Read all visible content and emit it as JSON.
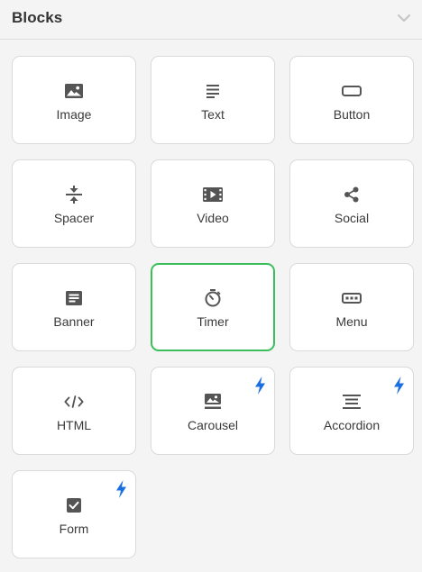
{
  "panel": {
    "title": "Blocks",
    "collapse_icon": "chevron-down-icon"
  },
  "colors": {
    "background": "#f4f4f4",
    "tile_background": "#ffffff",
    "tile_border": "#dadada",
    "selected_border": "#3cbf5a",
    "icon": "#555555",
    "bolt": "#1a6fe0"
  },
  "blocks": [
    {
      "label": "Image",
      "icon": "image-icon",
      "premium": false,
      "selected": false
    },
    {
      "label": "Text",
      "icon": "text-icon",
      "premium": false,
      "selected": false
    },
    {
      "label": "Button",
      "icon": "button-icon",
      "premium": false,
      "selected": false
    },
    {
      "label": "Spacer",
      "icon": "spacer-icon",
      "premium": false,
      "selected": false
    },
    {
      "label": "Video",
      "icon": "video-icon",
      "premium": false,
      "selected": false
    },
    {
      "label": "Social",
      "icon": "share-icon",
      "premium": false,
      "selected": false
    },
    {
      "label": "Banner",
      "icon": "banner-icon",
      "premium": false,
      "selected": false
    },
    {
      "label": "Timer",
      "icon": "timer-icon",
      "premium": false,
      "selected": true
    },
    {
      "label": "Menu",
      "icon": "menu-icon",
      "premium": false,
      "selected": false
    },
    {
      "label": "HTML",
      "icon": "code-icon",
      "premium": false,
      "selected": false
    },
    {
      "label": "Carousel",
      "icon": "carousel-icon",
      "premium": true,
      "selected": false
    },
    {
      "label": "Accordion",
      "icon": "accordion-icon",
      "premium": true,
      "selected": false
    },
    {
      "label": "Form",
      "icon": "checkbox-icon",
      "premium": true,
      "selected": false
    }
  ]
}
